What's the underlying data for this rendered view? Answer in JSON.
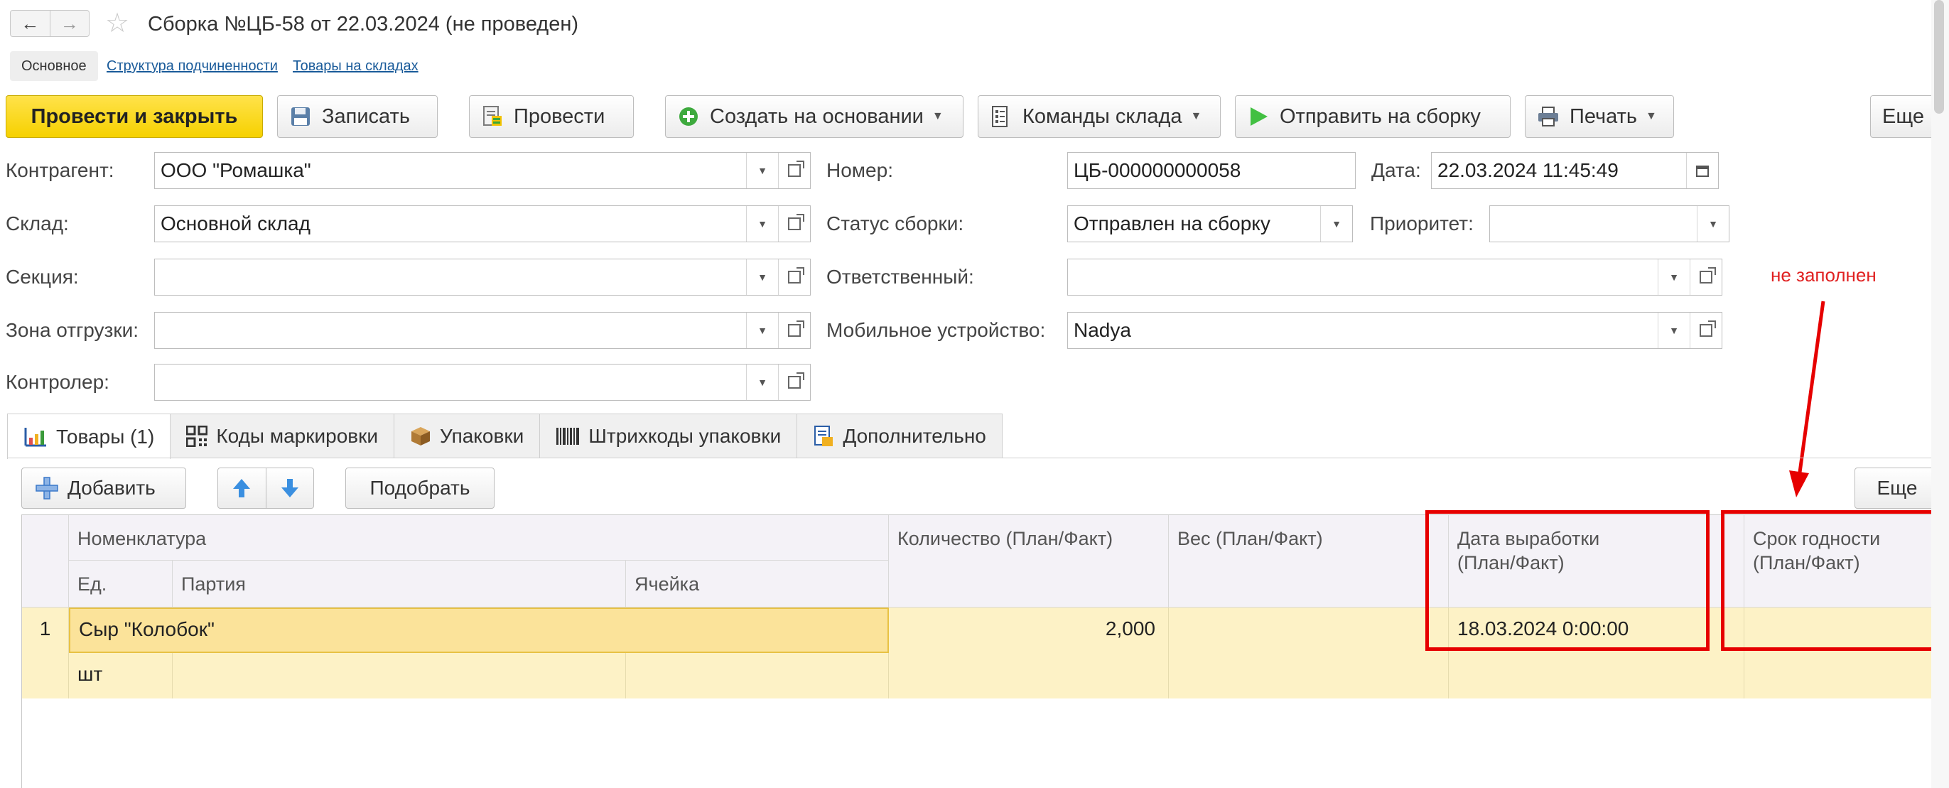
{
  "window": {
    "title": "Сборка №ЦБ-58 от 22.03.2024 (не проведен)"
  },
  "sections": [
    "Основное",
    "Структура подчиненности",
    "Товары на складах"
  ],
  "toolbar": {
    "post_close": "Провести и закрыть",
    "save": "Записать",
    "post": "Провести",
    "create_based": "Создать на основании",
    "warehouse_commands": "Команды склада",
    "send_to_assembly": "Отправить на сборку",
    "print": "Печать",
    "more": "Еще"
  },
  "form": {
    "counterparty": {
      "label": "Контрагент:",
      "value": "ООО \"Ромашка\""
    },
    "warehouse": {
      "label": "Склад:",
      "value": "Основной склад"
    },
    "section": {
      "label": "Секция:",
      "value": ""
    },
    "shipping_zone": {
      "label": "Зона отгрузки:",
      "value": ""
    },
    "controller": {
      "label": "Контролер:",
      "value": ""
    },
    "number": {
      "label": "Номер:",
      "value": "ЦБ-000000000058"
    },
    "date": {
      "label": "Дата:",
      "value": "22.03.2024 11:45:49"
    },
    "assembly_status": {
      "label": "Статус сборки:",
      "value": "Отправлен на сборку"
    },
    "priority": {
      "label": "Приоритет:",
      "value": ""
    },
    "responsible": {
      "label": "Ответственный:",
      "value": ""
    },
    "mobile_device": {
      "label": "Мобильное устройство:",
      "value": "Nadya"
    }
  },
  "tabs": [
    {
      "label": "Товары (1)",
      "icon": "chart-icon"
    },
    {
      "label": "Коды маркировки",
      "icon": "qr-icon"
    },
    {
      "label": "Упаковки",
      "icon": "box-icon"
    },
    {
      "label": "Штрихкоды упаковки",
      "icon": "barcode-icon"
    },
    {
      "label": "Дополнительно",
      "icon": "document-icon"
    }
  ],
  "table_toolbar": {
    "add": "Добавить",
    "pick": "Подобрать",
    "more": "Еще"
  },
  "table": {
    "headers": {
      "nomenclature": "Номенклатура",
      "unit": "Ед.",
      "batch": "Партия",
      "cell": "Ячейка",
      "quantity": "Количество (План/Факт)",
      "weight": "Вес (План/Факт)",
      "production_date_1": "Дата выработки",
      "production_date_2": "(План/Факт)",
      "expiry_1": "Срок годности",
      "expiry_2": "(План/Факт)"
    },
    "rows": [
      {
        "num": "1",
        "nomenclature": "Сыр \"Колобок\"",
        "unit": "шт",
        "batch": "",
        "cell": "",
        "quantity": "2,000",
        "weight": "",
        "production_date": "18.03.2024 0:00:00",
        "expiry": ""
      }
    ]
  },
  "annotation": {
    "note": "не заполнен",
    "color": "#e60000"
  }
}
